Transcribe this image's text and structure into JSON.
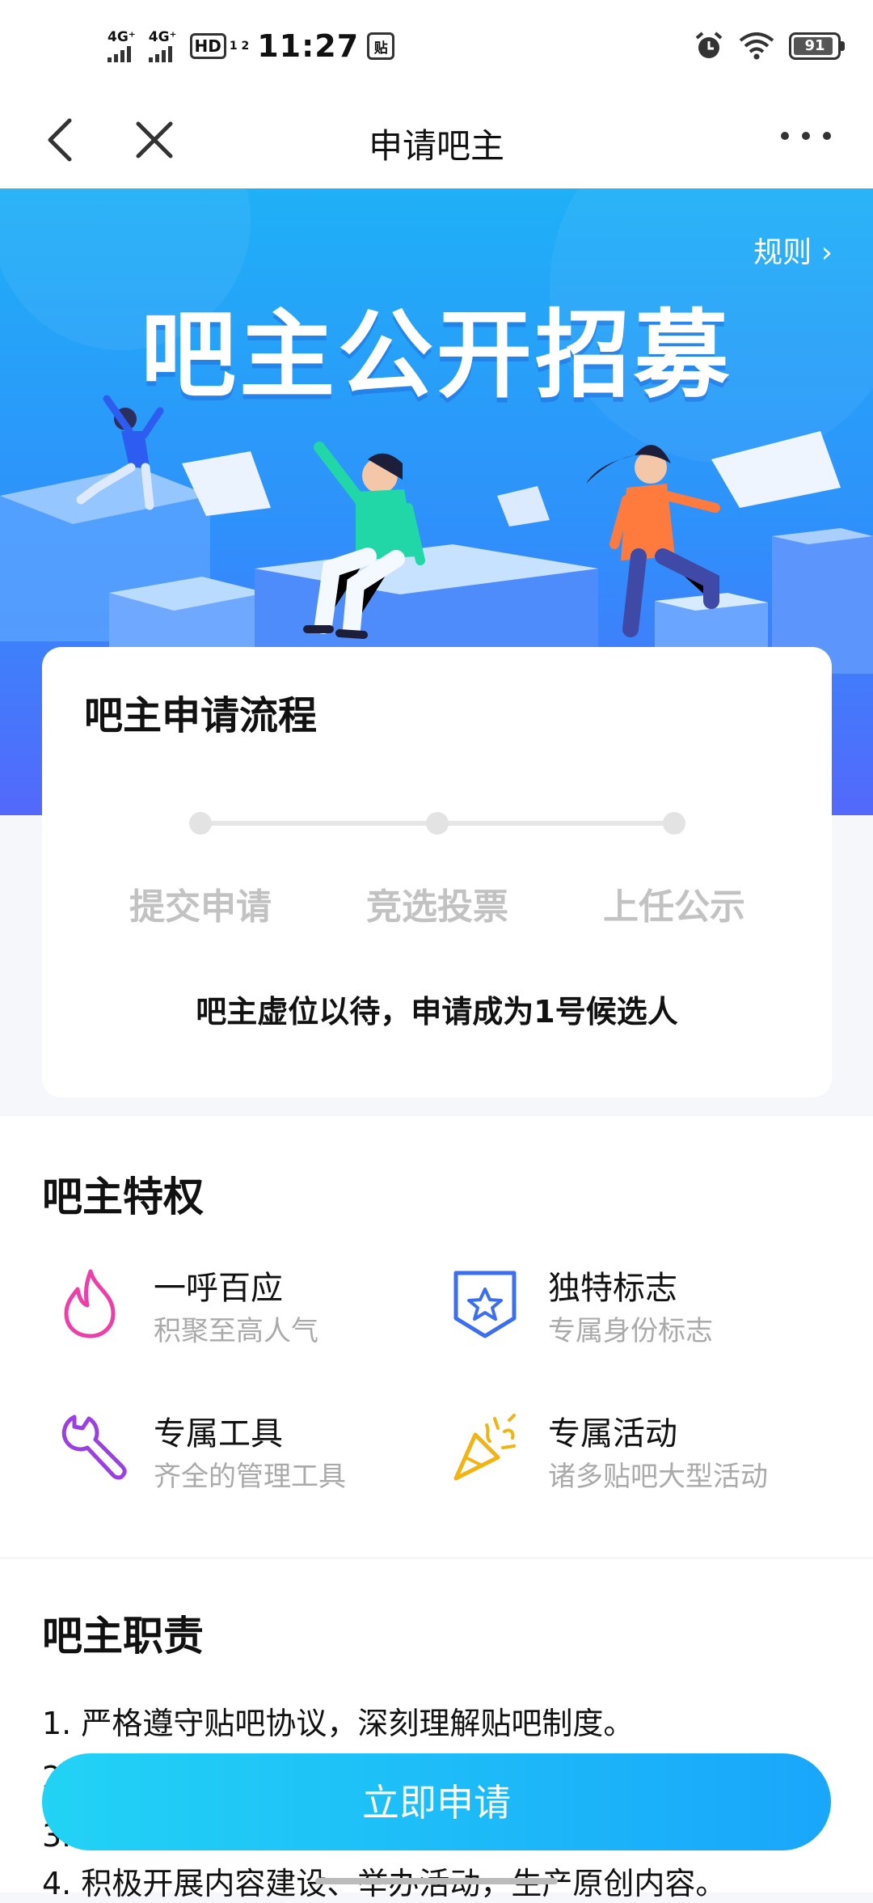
{
  "status_bar": {
    "net1": "4G⁺",
    "net2": "4G⁺",
    "hd": "HD",
    "hd_sub": "1 2",
    "time": "11:27",
    "tie_icon": "贴",
    "battery": "91"
  },
  "nav": {
    "title": "申请吧主"
  },
  "hero": {
    "rule_link": "规则 ›",
    "title": "吧主公开招募"
  },
  "process": {
    "title": "吧主申请流程",
    "steps": [
      "提交申请",
      "竞选投票",
      "上任公示"
    ],
    "note": "吧主虚位以待，申请成为1号候选人"
  },
  "privileges": {
    "title": "吧主特权",
    "items": [
      {
        "name": "一呼百应",
        "desc": "积聚至高人气",
        "icon": "flame-icon"
      },
      {
        "name": "独特标志",
        "desc": "专属身份标志",
        "icon": "star-badge-icon"
      },
      {
        "name": "专属工具",
        "desc": "齐全的管理工具",
        "icon": "wrench-icon"
      },
      {
        "name": "专属活动",
        "desc": "诸多贴吧大型活动",
        "icon": "party-popper-icon"
      }
    ]
  },
  "duties": {
    "title": "吧主职责",
    "items": [
      "1. 严格遵守贴吧协议，深刻理解贴吧制度。",
      "2.",
      "3.",
      "4. 积极开展内容建设、举办活动，生产原创内容。"
    ]
  },
  "apply_button": "立即申请",
  "colors": {
    "accent": "#1fa7fb",
    "hero_top": "#1fb0f7",
    "hero_bottom": "#5468fb"
  }
}
